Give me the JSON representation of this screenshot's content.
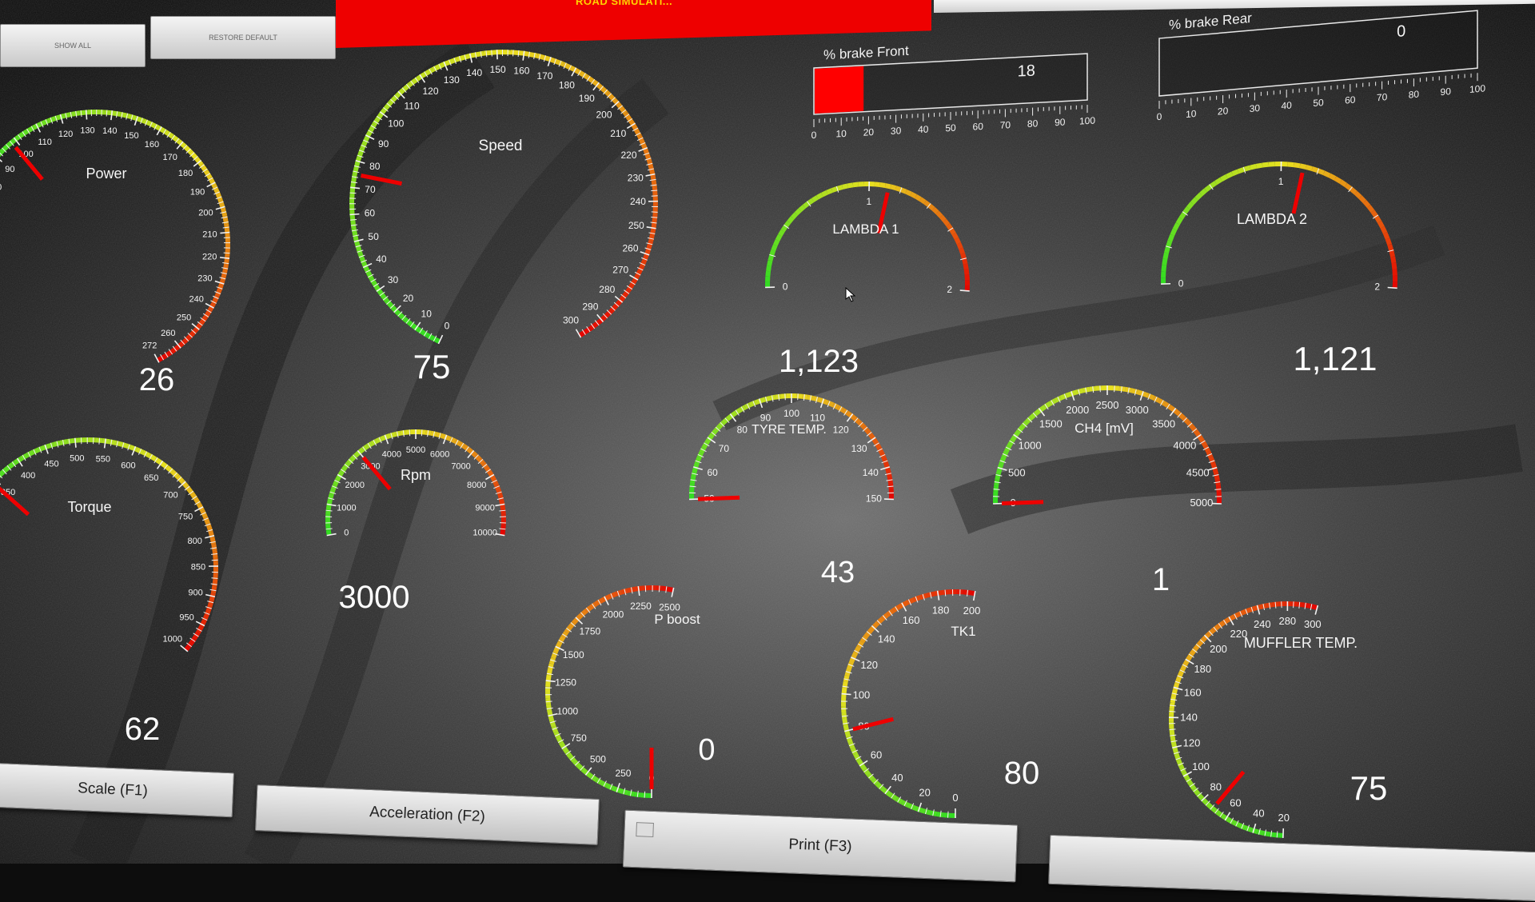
{
  "toolbar": {
    "show_all": "SHOW ALL",
    "restore_default": "RESTORE DEFAULT",
    "title": "ROAD SIMULATI..."
  },
  "brake_bars": [
    {
      "label": "% brake Front",
      "value": 18,
      "scale": [
        0,
        10,
        20,
        30,
        40,
        50,
        60,
        70,
        80,
        90,
        100
      ],
      "fill_fraction": 0.18
    },
    {
      "label": "% brake Rear",
      "value": 0,
      "scale": [
        0,
        10,
        20,
        30,
        40,
        50,
        60,
        70,
        80,
        90,
        100
      ],
      "fill_fraction": 0.0
    }
  ],
  "gauges": [
    {
      "id": "power",
      "label": "Power",
      "value_text": "26",
      "min": 0,
      "max": 272,
      "ticks": [
        "80",
        "90",
        "100",
        "110",
        "120",
        "130",
        "140",
        "150",
        "160",
        "170",
        "180",
        "190",
        "200",
        "210",
        "220",
        "230",
        "240",
        "250",
        "260",
        "272"
      ],
      "needle": 26
    },
    {
      "id": "speed",
      "label": "Speed",
      "value_text": "75",
      "min": 0,
      "max": 300,
      "ticks": [
        "0",
        "10",
        "20",
        "30",
        "40",
        "50",
        "60",
        "70",
        "80",
        "90",
        "100",
        "110",
        "120",
        "130",
        "140",
        "150",
        "160",
        "170",
        "180",
        "190",
        "200",
        "210",
        "220",
        "230",
        "240",
        "250",
        "260",
        "270",
        "280",
        "290",
        "300"
      ],
      "needle": 75
    },
    {
      "id": "lambda1",
      "label": "LAMBDA 1",
      "value_text": "1,123",
      "min": 0,
      "max": 2,
      "ticks": [
        "0",
        "1",
        "2"
      ],
      "needle": 1.123
    },
    {
      "id": "lambda2",
      "label": "LAMBDA 2",
      "value_text": "1,121",
      "min": 0,
      "max": 2,
      "ticks": [
        "0",
        "1",
        "2"
      ],
      "needle": 1.121
    },
    {
      "id": "torque",
      "label": "Torque",
      "value_text": "62",
      "min": 0,
      "max": 1000,
      "ticks": [
        "300",
        "350",
        "400",
        "450",
        "500",
        "550",
        "600",
        "650",
        "700",
        "750",
        "800",
        "850",
        "900",
        "950",
        "1000"
      ],
      "needle": 62
    },
    {
      "id": "rpm",
      "label": "Rpm",
      "value_text": "3000",
      "min": 0,
      "max": 10000,
      "ticks": [
        "0",
        "1000",
        "2000",
        "3000",
        "4000",
        "5000",
        "6000",
        "7000",
        "8000",
        "9000",
        "10000"
      ],
      "needle": 3000
    },
    {
      "id": "tyre",
      "label": "TYRE TEMP.",
      "value_text": "43",
      "min": 50,
      "max": 150,
      "ticks": [
        "50",
        "60",
        "70",
        "80",
        "90",
        "100",
        "110",
        "120",
        "130",
        "140",
        "150"
      ],
      "needle": 43
    },
    {
      "id": "ch4",
      "label": "CH4 [mV]",
      "value_text": "1",
      "min": 0,
      "max": 5000,
      "ticks": [
        "0",
        "500",
        "1000",
        "1500",
        "2000",
        "2500",
        "3000",
        "3500",
        "4000",
        "4500",
        "5000"
      ],
      "needle": 1
    },
    {
      "id": "pboost",
      "label": "P boost",
      "value_text": "0",
      "min": 0,
      "max": 2500,
      "ticks": [
        "0",
        "250",
        "500",
        "750",
        "1000",
        "1250",
        "1500",
        "1750",
        "2000",
        "2250",
        "2500"
      ],
      "needle": 0
    },
    {
      "id": "tk1",
      "label": "TK1",
      "value_text": "80",
      "min": 0,
      "max": 200,
      "ticks": [
        "0",
        "20",
        "40",
        "60",
        "80",
        "100",
        "120",
        "140",
        "160",
        "180",
        "200"
      ],
      "needle": 80
    },
    {
      "id": "muffler",
      "label": "MUFFLER TEMP.",
      "value_text": "75",
      "min": 20,
      "max": 300,
      "ticks": [
        "20",
        "40",
        "60",
        "80",
        "100",
        "120",
        "140",
        "160",
        "180",
        "200",
        "220",
        "240",
        "280",
        "300"
      ],
      "needle": 75
    }
  ],
  "bottom_buttons": {
    "scale": "Scale (F1)",
    "acceleration": "Acceleration (F2)",
    "print": "Print (F3)",
    "next": ""
  },
  "colors": {
    "scale_low": "#33dd22",
    "scale_mid": "#e8e020",
    "scale_high": "#e30000",
    "needle": "#ee0000",
    "brake_fill": "#ff0000"
  }
}
